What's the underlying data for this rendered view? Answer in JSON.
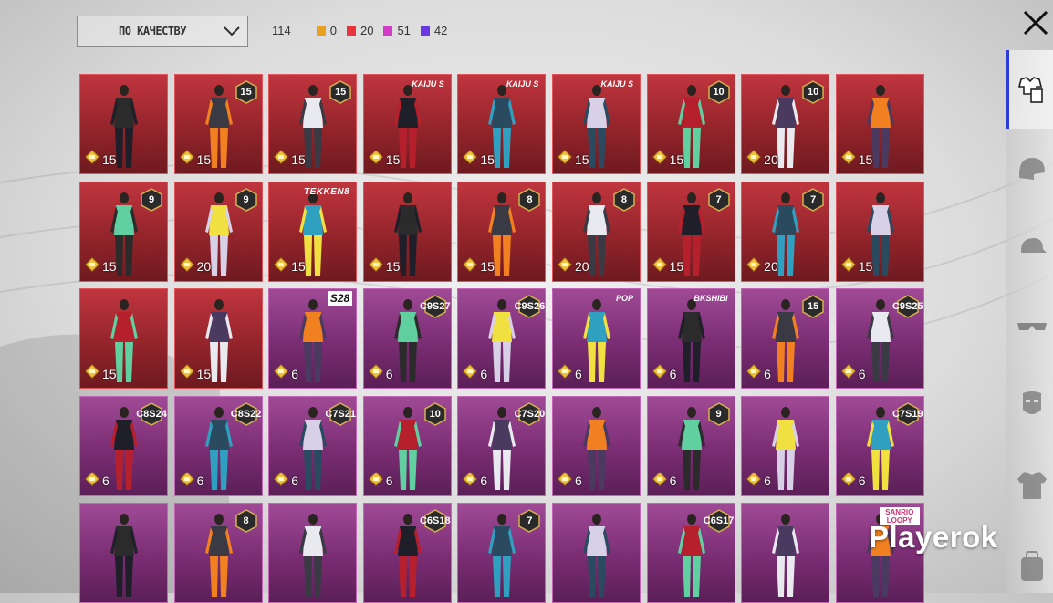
{
  "sort": {
    "label": "ПО КАЧЕСТВУ"
  },
  "stats": {
    "total": "114",
    "items": [
      {
        "value": "0",
        "color": "#e8a020"
      },
      {
        "value": "20",
        "color": "#e8333c"
      },
      {
        "value": "51",
        "color": "#d43ac8"
      },
      {
        "value": "42",
        "color": "#6a38e0"
      }
    ]
  },
  "watermark": "Playerok",
  "grid_items": [
    {
      "rarity": "red",
      "price": "15",
      "badge": "",
      "tag": ""
    },
    {
      "rarity": "red",
      "price": "15",
      "badge": "15",
      "tag": ""
    },
    {
      "rarity": "red",
      "price": "15",
      "badge": "15",
      "tag": ""
    },
    {
      "rarity": "red",
      "price": "15",
      "badge": "",
      "tag": "KAIJU S"
    },
    {
      "rarity": "red",
      "price": "15",
      "badge": "",
      "tag": "KAIJU S"
    },
    {
      "rarity": "red",
      "price": "15",
      "badge": "",
      "tag": "KAIJU S"
    },
    {
      "rarity": "red",
      "price": "15",
      "badge": "10",
      "tag": ""
    },
    {
      "rarity": "red",
      "price": "20",
      "badge": "10",
      "tag": ""
    },
    {
      "rarity": "red",
      "price": "15",
      "badge": "",
      "tag": ""
    },
    {
      "rarity": "red",
      "price": "15",
      "badge": "9",
      "tag": ""
    },
    {
      "rarity": "red",
      "price": "20",
      "badge": "9",
      "tag": ""
    },
    {
      "rarity": "red",
      "price": "15",
      "badge": "",
      "tag": "TEKKEN8"
    },
    {
      "rarity": "red",
      "price": "15",
      "badge": "",
      "tag": ""
    },
    {
      "rarity": "red",
      "price": "15",
      "badge": "8",
      "tag": ""
    },
    {
      "rarity": "red",
      "price": "20",
      "badge": "8",
      "tag": ""
    },
    {
      "rarity": "red",
      "price": "15",
      "badge": "7",
      "tag": ""
    },
    {
      "rarity": "red",
      "price": "20",
      "badge": "7",
      "tag": ""
    },
    {
      "rarity": "red",
      "price": "15",
      "badge": "",
      "tag": ""
    },
    {
      "rarity": "red",
      "price": "15",
      "badge": "",
      "tag": ""
    },
    {
      "rarity": "red",
      "price": "15",
      "badge": "",
      "tag": ""
    },
    {
      "rarity": "purple",
      "price": "6",
      "badge": "",
      "tag": "S28"
    },
    {
      "rarity": "purple",
      "price": "6",
      "badge": "C9S27",
      "tag": ""
    },
    {
      "rarity": "purple",
      "price": "6",
      "badge": "C9S26",
      "tag": ""
    },
    {
      "rarity": "purple",
      "price": "6",
      "badge": "",
      "tag": "POP"
    },
    {
      "rarity": "purple",
      "price": "6",
      "badge": "",
      "tag": "BKSHIBI"
    },
    {
      "rarity": "purple",
      "price": "6",
      "badge": "15",
      "tag": ""
    },
    {
      "rarity": "purple",
      "price": "6",
      "badge": "C9S25",
      "tag": ""
    },
    {
      "rarity": "purple",
      "price": "6",
      "badge": "C8S24",
      "tag": ""
    },
    {
      "rarity": "purple",
      "price": "6",
      "badge": "C8S22",
      "tag": ""
    },
    {
      "rarity": "purple",
      "price": "6",
      "badge": "C7S21",
      "tag": ""
    },
    {
      "rarity": "purple",
      "price": "6",
      "badge": "10",
      "tag": ""
    },
    {
      "rarity": "purple",
      "price": "6",
      "badge": "C7S20",
      "tag": ""
    },
    {
      "rarity": "purple",
      "price": "6",
      "badge": "",
      "tag": ""
    },
    {
      "rarity": "purple",
      "price": "6",
      "badge": "9",
      "tag": ""
    },
    {
      "rarity": "purple",
      "price": "6",
      "badge": "",
      "tag": ""
    },
    {
      "rarity": "purple",
      "price": "6",
      "badge": "C7S19",
      "tag": ""
    },
    {
      "rarity": "purple",
      "price": "",
      "badge": "",
      "tag": ""
    },
    {
      "rarity": "purple",
      "price": "",
      "badge": "8",
      "tag": ""
    },
    {
      "rarity": "purple",
      "price": "",
      "badge": "",
      "tag": ""
    },
    {
      "rarity": "purple",
      "price": "",
      "badge": "C6S18",
      "tag": ""
    },
    {
      "rarity": "purple",
      "price": "",
      "badge": "7",
      "tag": ""
    },
    {
      "rarity": "purple",
      "price": "",
      "badge": "",
      "tag": ""
    },
    {
      "rarity": "purple",
      "price": "",
      "badge": "C6S17",
      "tag": ""
    },
    {
      "rarity": "purple",
      "price": "",
      "badge": "",
      "tag": ""
    },
    {
      "rarity": "purple",
      "price": "",
      "badge": "",
      "tag": "SANRIO LOOPY"
    }
  ],
  "right_icons": [
    "outfit-icon",
    "helmet-icon",
    "cap-icon",
    "glasses-icon",
    "mask-icon",
    "jacket-icon",
    "backpack-icon"
  ]
}
